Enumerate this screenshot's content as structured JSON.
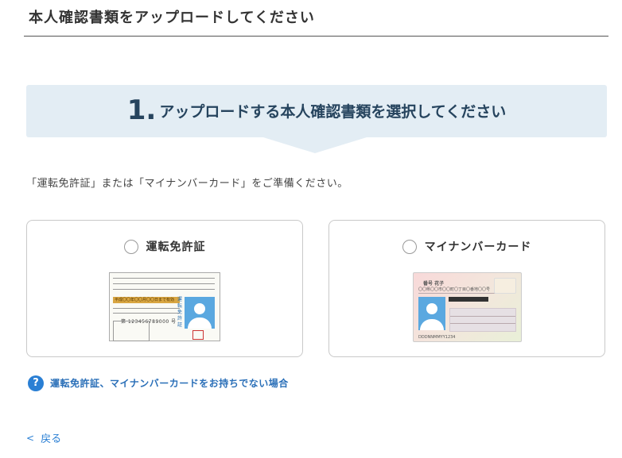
{
  "header": {
    "title": "本人確認書類をアップロードしてください"
  },
  "step": {
    "number": "1.",
    "title": "アップロードする本人確認書類を選択してください"
  },
  "instruction": "「運転免許証」または「マイナンバーカード」をご準備ください。",
  "options": [
    {
      "label": "運転免許証",
      "selected": false
    },
    {
      "label": "マイナンバーカード",
      "selected": false
    }
  ],
  "license_art": {
    "band_text": "平成〇〇年〇〇月〇〇日まで有効",
    "vertical_text": "運転免許証",
    "number_text": "第 123456789000 号"
  },
  "mynumber_art": {
    "name_text": "番号 花子",
    "address_text": "〇〇県〇〇市〇〇町〇丁目〇番地〇〇号",
    "barcode_text": "DDDNNMMYY1234"
  },
  "help_link": {
    "text": "運転免許証、マイナンバーカードをお持ちでない場合",
    "icon": "question-circle-icon"
  },
  "back_link": {
    "text": "戻る",
    "icon": "chevron-left-icon"
  },
  "colors": {
    "banner_bg": "#e3edf4",
    "heading": "#26445e",
    "link": "#2a7fd4"
  }
}
